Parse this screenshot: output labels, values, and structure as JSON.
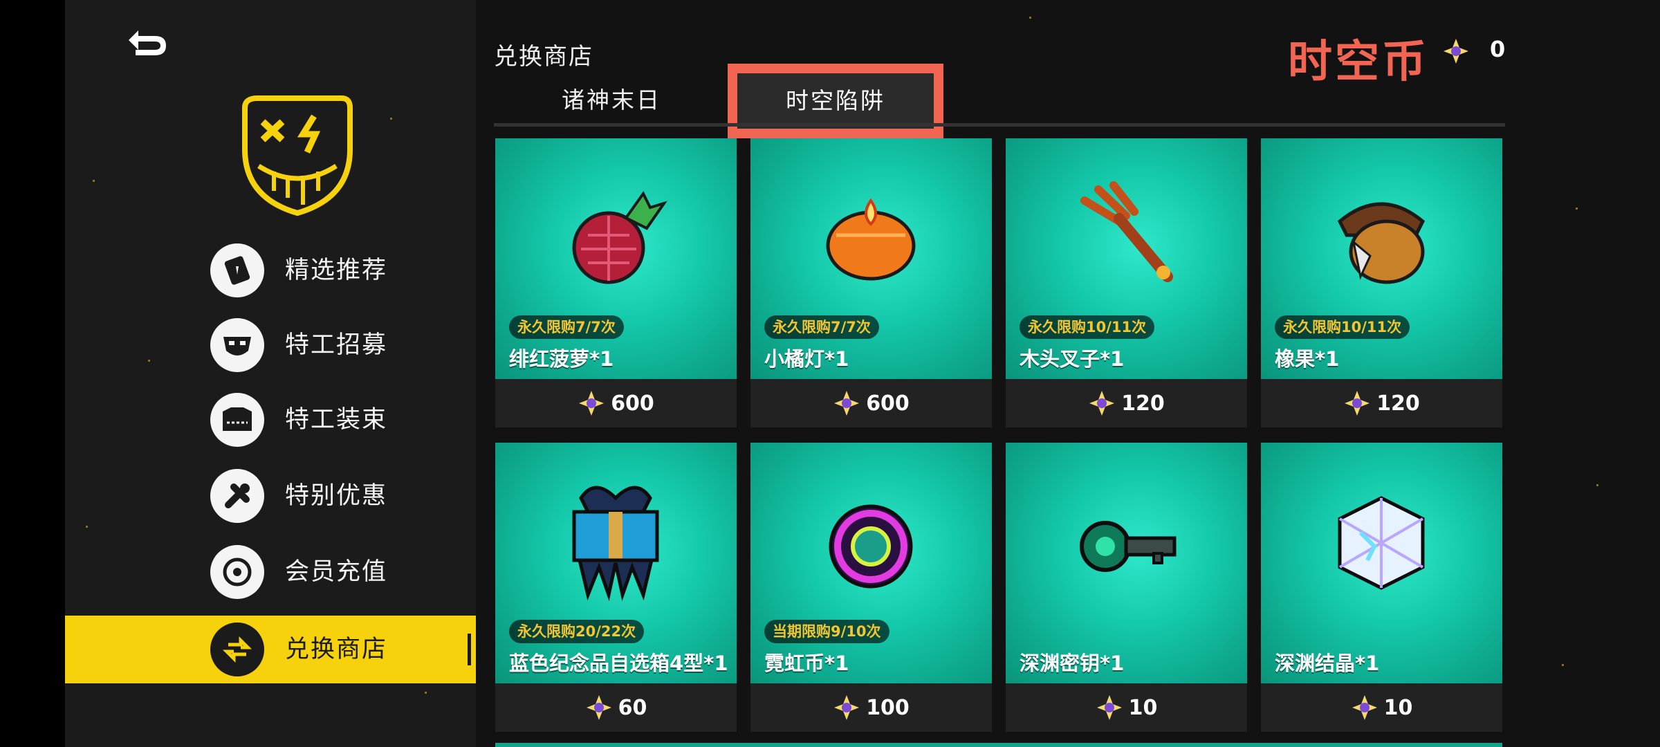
{
  "sidebar": {
    "items": [
      {
        "label": "精选推荐",
        "icon": "card-icon"
      },
      {
        "label": "特工招募",
        "icon": "agent-face-icon"
      },
      {
        "label": "特工装束",
        "icon": "outfit-icon"
      },
      {
        "label": "特别优惠",
        "icon": "wrench-icon"
      },
      {
        "label": "会员充值",
        "icon": "target-icon"
      },
      {
        "label": "兑换商店",
        "icon": "exchange-icon",
        "active": true
      }
    ]
  },
  "header": {
    "title": "兑换商店",
    "currency_label": "时空币",
    "currency_value": "0",
    "currency_icon": "star-coin-icon"
  },
  "tabs": [
    {
      "label": "诸神末日"
    },
    {
      "label": "时空陷阱",
      "active": true
    }
  ],
  "items": [
    {
      "name": "绯红菠萝*1",
      "limit": "永久限购7/7次",
      "price": "600",
      "icon": "pineapple-icon"
    },
    {
      "name": "小橘灯*1",
      "limit": "永久限购7/7次",
      "price": "600",
      "icon": "orange-lamp-icon"
    },
    {
      "name": "木头叉子*1",
      "limit": "永久限购10/11次",
      "price": "120",
      "icon": "wooden-fork-icon"
    },
    {
      "name": "橡果*1",
      "limit": "永久限购10/11次",
      "price": "120",
      "icon": "acorn-icon"
    },
    {
      "name": "蓝色纪念品自选箱4型*1",
      "limit": "永久限购20/22次",
      "price": "60",
      "icon": "gift-box-icon"
    },
    {
      "name": "霓虹币*1",
      "limit": "当期限购9/10次",
      "price": "100",
      "icon": "neon-coin-icon"
    },
    {
      "name": "深渊密钥*1",
      "limit": "",
      "price": "10",
      "icon": "abyss-key-icon"
    },
    {
      "name": "深渊结晶*1",
      "limit": "",
      "price": "10",
      "icon": "abyss-crystal-icon"
    }
  ],
  "colors": {
    "accent_yellow": "#f6d20d",
    "highlight_red": "#f26552",
    "card_teal": "#14c9aa",
    "badge_gold": "#f3c531"
  }
}
